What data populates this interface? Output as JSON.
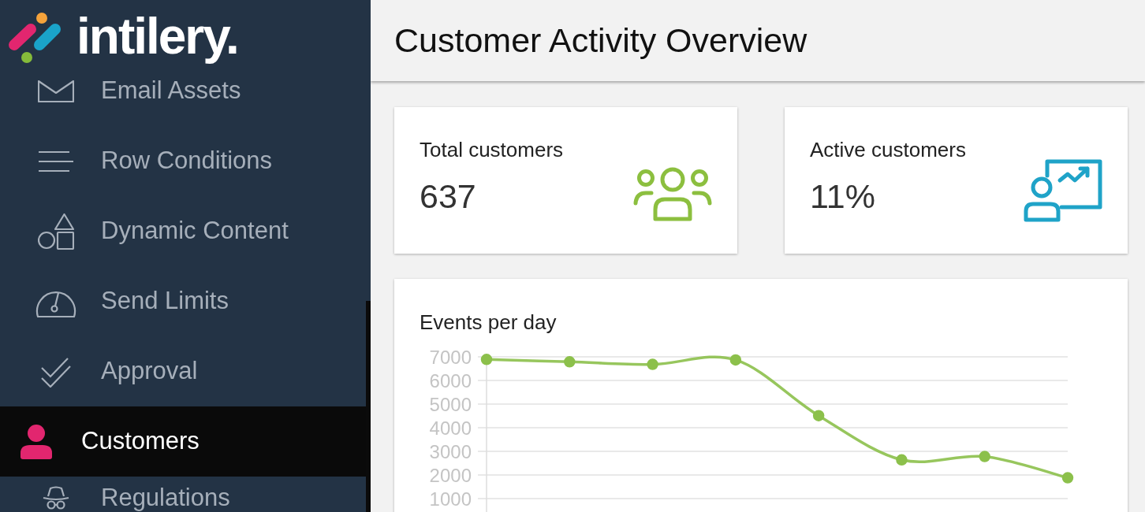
{
  "logo": {
    "text": "intilery."
  },
  "sidebar": {
    "items": [
      {
        "label": "Email Assets",
        "selected": false
      },
      {
        "label": "Row Conditions",
        "selected": false
      },
      {
        "label": "Dynamic Content",
        "selected": false
      },
      {
        "label": "Send Limits",
        "selected": false
      },
      {
        "label": "Approval",
        "selected": false
      },
      {
        "label": "Customers",
        "selected": true
      },
      {
        "label": "Regulations",
        "selected": false
      }
    ]
  },
  "header": {
    "title": "Customer Activity Overview"
  },
  "stats": [
    {
      "label": "Total customers",
      "value": "637",
      "color": "#8cbf3f"
    },
    {
      "label": "Active customers",
      "value": "11%",
      "color": "#1fa3c8"
    }
  ],
  "chart": {
    "chart_data": {
      "type": "line",
      "title": "Events per day",
      "ylim": [
        0,
        7000
      ],
      "yticks": [
        1000,
        2000,
        3000,
        4000,
        5000,
        6000,
        7000
      ],
      "grid": true,
      "series": [
        {
          "color": "#8cc04b",
          "marker": "circle",
          "values": [
            6890,
            6790,
            6680,
            6870,
            4510,
            2640,
            2780,
            1880
          ]
        }
      ]
    }
  }
}
